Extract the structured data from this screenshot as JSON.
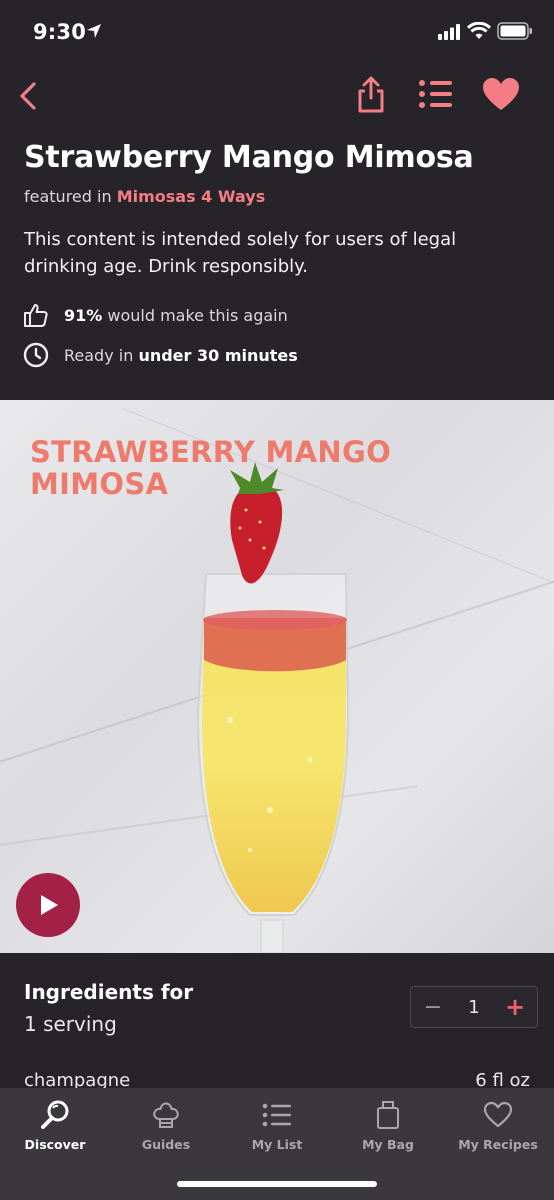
{
  "status_bar": {
    "time": "9:30"
  },
  "colors": {
    "accent": "#f47d86",
    "background": "#262429",
    "tabbar": "#3a383d",
    "play_button": "#a32046"
  },
  "nav": {
    "back_icon": "chevron-left-icon",
    "share_icon": "share-icon",
    "list_icon": "list-icon",
    "favorite_icon": "heart-icon"
  },
  "recipe": {
    "title": "Strawberry Mango Mimosa",
    "featured_prefix": "featured in",
    "featured_link": "Mimosas 4 Ways",
    "disclaimer": "This content is intended solely for users of legal drinking age. Drink responsibly.",
    "rating_percent": "91%",
    "rating_text": "would make this again",
    "time_prefix": "Ready in",
    "time_value": "under 30 minutes"
  },
  "hero": {
    "overlay_title": "STRAWBERRY MANGO MIMOSA",
    "play_icon": "play-icon"
  },
  "ingredients": {
    "heading": "Ingredients for",
    "servings_label": "1 serving",
    "stepper": {
      "minus": "−",
      "value": "1",
      "plus": "+"
    },
    "items": [
      {
        "name": "champagne",
        "amount": "6 fl oz"
      }
    ]
  },
  "tabbar": {
    "tabs": [
      {
        "label": "Discover",
        "icon": "search-icon",
        "active": true
      },
      {
        "label": "Guides",
        "icon": "chef-hat-icon",
        "active": false
      },
      {
        "label": "My List",
        "icon": "list-icon",
        "active": false
      },
      {
        "label": "My Bag",
        "icon": "bag-icon",
        "active": false
      },
      {
        "label": "My Recipes",
        "icon": "heart-icon",
        "active": false
      }
    ]
  }
}
